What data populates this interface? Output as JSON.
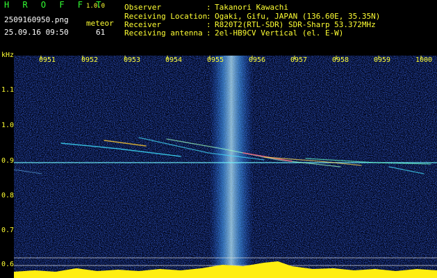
{
  "header": {
    "title": "H R O F F T",
    "version": "1.0.0",
    "filename": "2509160950.png",
    "datetime": "25.09.16 09:50",
    "meteor_label": "meteor",
    "meteor_count": "61"
  },
  "info": [
    {
      "key": "Observer",
      "value": "Takanori Kawachi"
    },
    {
      "key": "Receiving Location",
      "value": "Ogaki, Gifu, JAPAN (136.60E, 35.35N)"
    },
    {
      "key": "Receiver",
      "value": "R820T2(RTL-SDR) SDR-Sharp 53.372MHz"
    },
    {
      "key": "Receiving antenna",
      "value": "2el-HB9CV Vertical (el. E-W)"
    }
  ],
  "plot": {
    "y_unit": "kHz",
    "x_ticks": [
      "0951",
      "0952",
      "0953",
      "0954",
      "0955",
      "0956",
      "0957",
      "0958",
      "0959",
      "1000"
    ],
    "y_ticks": [
      "1.1",
      "1.0",
      "0.9",
      "0.8",
      "0.7",
      "0.6"
    ]
  },
  "colors": {
    "accent_green": "#33ff33",
    "label_yellow": "#ffff33",
    "background": "#000000"
  }
}
